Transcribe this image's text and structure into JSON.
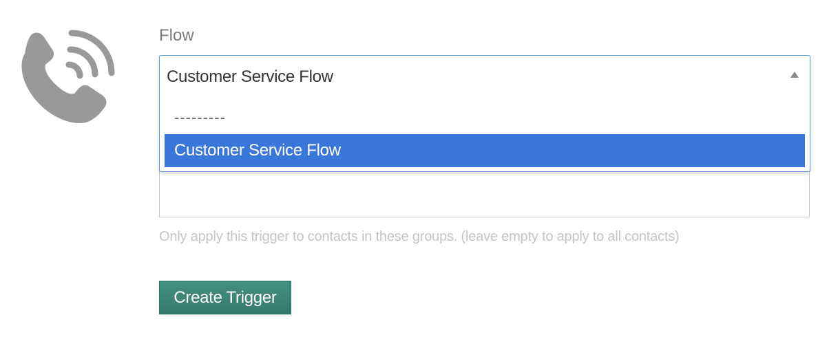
{
  "form": {
    "flow_label": "Flow",
    "flow_select": {
      "selected_value": "Customer Service Flow",
      "options": [
        {
          "label": "---------"
        },
        {
          "label": "Customer Service Flow",
          "highlighted": true
        }
      ]
    },
    "groups_help_text": "Only apply this trigger to contacts in these groups. (leave empty to apply to all contacts)",
    "submit_label": "Create Trigger"
  },
  "icons": {
    "trigger_icon": "phone-call-icon"
  },
  "colors": {
    "highlight": "#3b77da",
    "button": "#3d8676",
    "icon": "#999999",
    "select_border": "#5b8fd6"
  }
}
